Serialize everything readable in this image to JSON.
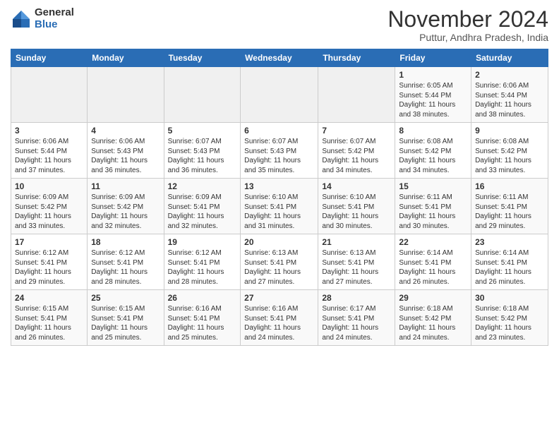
{
  "header": {
    "logo_general": "General",
    "logo_blue": "Blue",
    "month_title": "November 2024",
    "location": "Puttur, Andhra Pradesh, India"
  },
  "days_of_week": [
    "Sunday",
    "Monday",
    "Tuesday",
    "Wednesday",
    "Thursday",
    "Friday",
    "Saturday"
  ],
  "weeks": [
    [
      {
        "day": "",
        "info": ""
      },
      {
        "day": "",
        "info": ""
      },
      {
        "day": "",
        "info": ""
      },
      {
        "day": "",
        "info": ""
      },
      {
        "day": "",
        "info": ""
      },
      {
        "day": "1",
        "info": "Sunrise: 6:05 AM\nSunset: 5:44 PM\nDaylight: 11 hours and 38 minutes."
      },
      {
        "day": "2",
        "info": "Sunrise: 6:06 AM\nSunset: 5:44 PM\nDaylight: 11 hours and 38 minutes."
      }
    ],
    [
      {
        "day": "3",
        "info": "Sunrise: 6:06 AM\nSunset: 5:44 PM\nDaylight: 11 hours and 37 minutes."
      },
      {
        "day": "4",
        "info": "Sunrise: 6:06 AM\nSunset: 5:43 PM\nDaylight: 11 hours and 36 minutes."
      },
      {
        "day": "5",
        "info": "Sunrise: 6:07 AM\nSunset: 5:43 PM\nDaylight: 11 hours and 36 minutes."
      },
      {
        "day": "6",
        "info": "Sunrise: 6:07 AM\nSunset: 5:43 PM\nDaylight: 11 hours and 35 minutes."
      },
      {
        "day": "7",
        "info": "Sunrise: 6:07 AM\nSunset: 5:42 PM\nDaylight: 11 hours and 34 minutes."
      },
      {
        "day": "8",
        "info": "Sunrise: 6:08 AM\nSunset: 5:42 PM\nDaylight: 11 hours and 34 minutes."
      },
      {
        "day": "9",
        "info": "Sunrise: 6:08 AM\nSunset: 5:42 PM\nDaylight: 11 hours and 33 minutes."
      }
    ],
    [
      {
        "day": "10",
        "info": "Sunrise: 6:09 AM\nSunset: 5:42 PM\nDaylight: 11 hours and 33 minutes."
      },
      {
        "day": "11",
        "info": "Sunrise: 6:09 AM\nSunset: 5:42 PM\nDaylight: 11 hours and 32 minutes."
      },
      {
        "day": "12",
        "info": "Sunrise: 6:09 AM\nSunset: 5:41 PM\nDaylight: 11 hours and 32 minutes."
      },
      {
        "day": "13",
        "info": "Sunrise: 6:10 AM\nSunset: 5:41 PM\nDaylight: 11 hours and 31 minutes."
      },
      {
        "day": "14",
        "info": "Sunrise: 6:10 AM\nSunset: 5:41 PM\nDaylight: 11 hours and 30 minutes."
      },
      {
        "day": "15",
        "info": "Sunrise: 6:11 AM\nSunset: 5:41 PM\nDaylight: 11 hours and 30 minutes."
      },
      {
        "day": "16",
        "info": "Sunrise: 6:11 AM\nSunset: 5:41 PM\nDaylight: 11 hours and 29 minutes."
      }
    ],
    [
      {
        "day": "17",
        "info": "Sunrise: 6:12 AM\nSunset: 5:41 PM\nDaylight: 11 hours and 29 minutes."
      },
      {
        "day": "18",
        "info": "Sunrise: 6:12 AM\nSunset: 5:41 PM\nDaylight: 11 hours and 28 minutes."
      },
      {
        "day": "19",
        "info": "Sunrise: 6:12 AM\nSunset: 5:41 PM\nDaylight: 11 hours and 28 minutes."
      },
      {
        "day": "20",
        "info": "Sunrise: 6:13 AM\nSunset: 5:41 PM\nDaylight: 11 hours and 27 minutes."
      },
      {
        "day": "21",
        "info": "Sunrise: 6:13 AM\nSunset: 5:41 PM\nDaylight: 11 hours and 27 minutes."
      },
      {
        "day": "22",
        "info": "Sunrise: 6:14 AM\nSunset: 5:41 PM\nDaylight: 11 hours and 26 minutes."
      },
      {
        "day": "23",
        "info": "Sunrise: 6:14 AM\nSunset: 5:41 PM\nDaylight: 11 hours and 26 minutes."
      }
    ],
    [
      {
        "day": "24",
        "info": "Sunrise: 6:15 AM\nSunset: 5:41 PM\nDaylight: 11 hours and 26 minutes."
      },
      {
        "day": "25",
        "info": "Sunrise: 6:15 AM\nSunset: 5:41 PM\nDaylight: 11 hours and 25 minutes."
      },
      {
        "day": "26",
        "info": "Sunrise: 6:16 AM\nSunset: 5:41 PM\nDaylight: 11 hours and 25 minutes."
      },
      {
        "day": "27",
        "info": "Sunrise: 6:16 AM\nSunset: 5:41 PM\nDaylight: 11 hours and 24 minutes."
      },
      {
        "day": "28",
        "info": "Sunrise: 6:17 AM\nSunset: 5:41 PM\nDaylight: 11 hours and 24 minutes."
      },
      {
        "day": "29",
        "info": "Sunrise: 6:18 AM\nSunset: 5:42 PM\nDaylight: 11 hours and 24 minutes."
      },
      {
        "day": "30",
        "info": "Sunrise: 6:18 AM\nSunset: 5:42 PM\nDaylight: 11 hours and 23 minutes."
      }
    ]
  ]
}
